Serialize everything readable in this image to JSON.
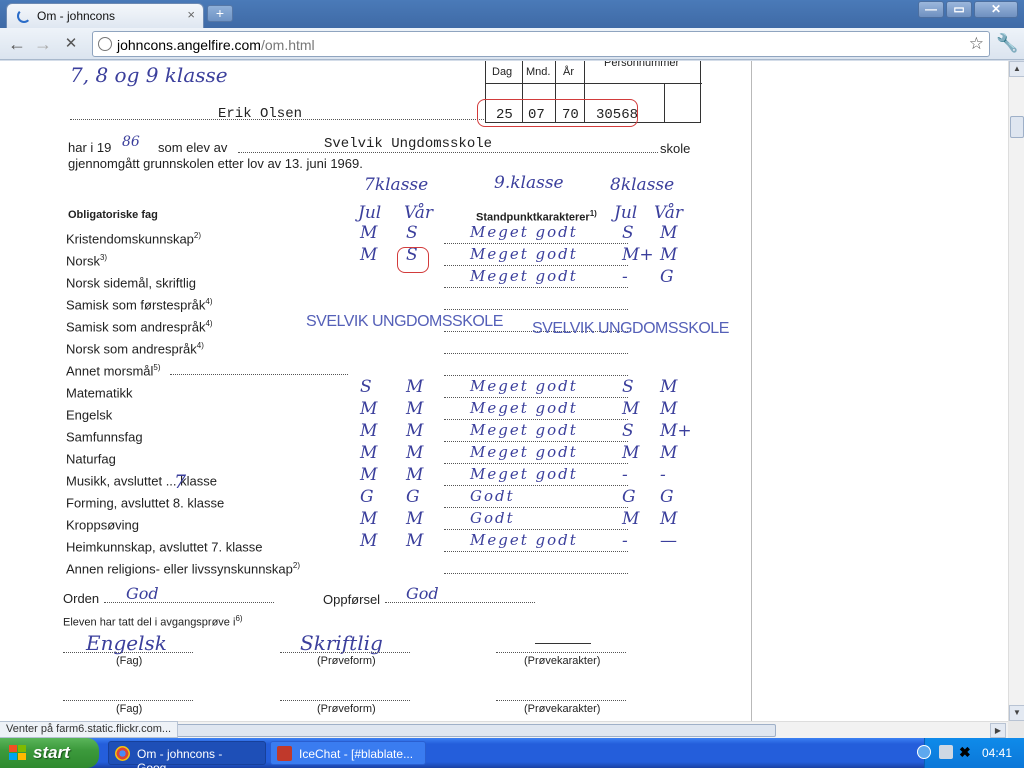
{
  "browser": {
    "tab_title": "Om - johncons",
    "tab_close": "×",
    "new_tab": "+",
    "window_min": "—",
    "window_max": "▭",
    "window_close": "✕",
    "url_host": "johncons.angelfire.com",
    "url_path": "/om.html",
    "nav_back": "←",
    "nav_forward": "→",
    "nav_stop": "✕",
    "star": "☆",
    "wrench": "🔧",
    "status_text": "Venter på farm6.static.flickr.com..."
  },
  "document": {
    "top_handwritten": "7, 8 og 9 klasse",
    "student_name": "Erik Olsen",
    "date_headers": [
      "Dag",
      "Mnd.",
      "År"
    ],
    "personnummer_label": "Personnummer",
    "birth_day": "25",
    "birth_month": "07",
    "birth_year": "70",
    "personnummer": "30568",
    "har_prefix": "har i 19",
    "year_hw": "86",
    "som_elev": "som elev av",
    "school_name": "Svelvik Ungdomsskole",
    "skole": "skole",
    "completed_line": "gjennomgått grunnskolen etter lov av 13. juni 1969.",
    "col_7klasse": "7klasse",
    "col_9klasse": "9.klasse",
    "col_8klasse": "8klasse",
    "obligatoriske": "Obligatoriske fag",
    "standpunkt": "Standpunktkarakterer",
    "standpunkt_sup": "1)",
    "jul_label": "Jul",
    "var_label": "Vår",
    "stamp_left": "SVELVIK UNGDOMSSKOLE",
    "stamp_right": "SVELVIK UNGDOMSSKOLE",
    "subjects": [
      {
        "name": "Kristendomskunnskap",
        "sup": "2)",
        "g7_jul": "M",
        "g7_var": "S",
        "g9": "Meget godt",
        "g8_jul": "S",
        "g8_var": "M"
      },
      {
        "name": "Norsk",
        "sup": "3)",
        "g7_jul": "M",
        "g7_var": "S",
        "g9": "Meget godt",
        "g8_jul": "M+",
        "g8_var": "M"
      },
      {
        "name": "Norsk sidemål, skriftlig",
        "sup": "",
        "g7_jul": "",
        "g7_var": "",
        "g9": "Meget godt",
        "g8_jul": "-",
        "g8_var": "G"
      },
      {
        "name": "Samisk som førstespråk",
        "sup": "4)",
        "g7_jul": "",
        "g7_var": "",
        "g9": "",
        "g8_jul": "",
        "g8_var": ""
      },
      {
        "name": "Samisk som andrespråk",
        "sup": "4)",
        "g7_jul": "",
        "g7_var": "",
        "g9": "",
        "g8_jul": "",
        "g8_var": ""
      },
      {
        "name": "Norsk som andrespråk",
        "sup": "4)",
        "g7_jul": "",
        "g7_var": "",
        "g9": "",
        "g8_jul": "",
        "g8_var": ""
      },
      {
        "name": "Annet morsmål",
        "sup": "5)",
        "g7_jul": "",
        "g7_var": "",
        "g9": "",
        "g8_jul": "",
        "g8_var": ""
      },
      {
        "name": "Matematikk",
        "sup": "",
        "g7_jul": "S",
        "g7_var": "M",
        "g9": "Meget godt",
        "g8_jul": "S",
        "g8_var": "M"
      },
      {
        "name": "Engelsk",
        "sup": "",
        "g7_jul": "M",
        "g7_var": "M",
        "g9": "Meget godt",
        "g8_jul": "M",
        "g8_var": "M"
      },
      {
        "name": "Samfunnsfag",
        "sup": "",
        "g7_jul": "M",
        "g7_var": "M",
        "g9": "Meget godt",
        "g8_jul": "S",
        "g8_var": "M+"
      },
      {
        "name": "Naturfag",
        "sup": "",
        "g7_jul": "M",
        "g7_var": "M",
        "g9": "Meget godt",
        "g8_jul": "M",
        "g8_var": "M"
      },
      {
        "name": "Musikk, avsluttet ... klasse",
        "sup": "",
        "g7_jul": "M",
        "g7_var": "M",
        "g9": "Meget godt",
        "g8_jul": "-",
        "g8_var": "-"
      },
      {
        "name": "Forming, avsluttet 8. klasse",
        "sup": "",
        "g7_jul": "G",
        "g7_var": "G",
        "g9": "Godt",
        "g8_jul": "G",
        "g8_var": "G"
      },
      {
        "name": "Kroppsøving",
        "sup": "",
        "g7_jul": "M",
        "g7_var": "M",
        "g9": "Godt",
        "g8_jul": "M",
        "g8_var": "M"
      },
      {
        "name": "Heimkunnskap, avsluttet 7. klasse",
        "sup": "",
        "g7_jul": "M",
        "g7_var": "M",
        "g9": "Meget godt",
        "g8_jul": "-",
        "g8_var": "—"
      },
      {
        "name": "Annen religions- eller livssynskunnskap",
        "sup": "2)",
        "g7_jul": "",
        "g7_var": "",
        "g9": "",
        "g8_jul": "",
        "g8_var": ""
      }
    ],
    "musikk_hw": "7",
    "orden_label": "Orden",
    "orden_value": "God",
    "oppforsel_label": "Oppførsel",
    "oppforsel_value": "God",
    "avgangsprove_line": "Eleven har tatt del i avgangsprøve i",
    "avgangsprove_sup": "6)",
    "exam_subject": "Engelsk",
    "exam_form": "Skriftlig",
    "label_fag": "(Fag)",
    "label_proveform": "(Prøveform)",
    "label_provekarakter": "(Prøvekarakter)"
  },
  "taskbar": {
    "start_label": "start",
    "tasks": [
      {
        "label": "Om - johncons - Goog..."
      },
      {
        "label": "IceChat - [#blablate..."
      }
    ],
    "clock": "04:41"
  },
  "colors": {
    "taskbar_blue": "#245edb",
    "start_green": "#3c9a3c",
    "handwriting_ink": "#3b3f9c",
    "stamp_ink": "#5560b8",
    "highlight_red": "#d23b3b"
  }
}
